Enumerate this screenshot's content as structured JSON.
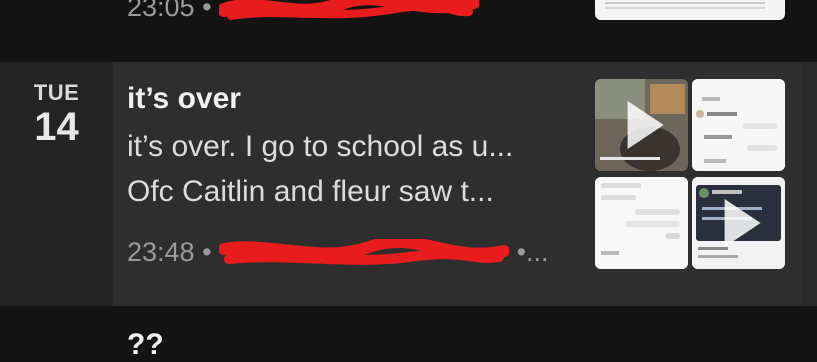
{
  "entries": {
    "top": {
      "time": "23:05",
      "separator": "•"
    },
    "selected": {
      "weekday": "TUE",
      "day": "14",
      "title": "it’s over",
      "preview_line_1": "it’s over. I go to school as u...",
      "preview_line_2": "Ofc Caitlin and fleur saw t...",
      "time": "23:48",
      "separator": "•",
      "meta_ellipsis": "•..."
    },
    "bottom": {
      "title": "??"
    }
  },
  "colors": {
    "background": "#131313",
    "selected_bg": "#2e2e2e",
    "redaction": "#e81c1c"
  }
}
